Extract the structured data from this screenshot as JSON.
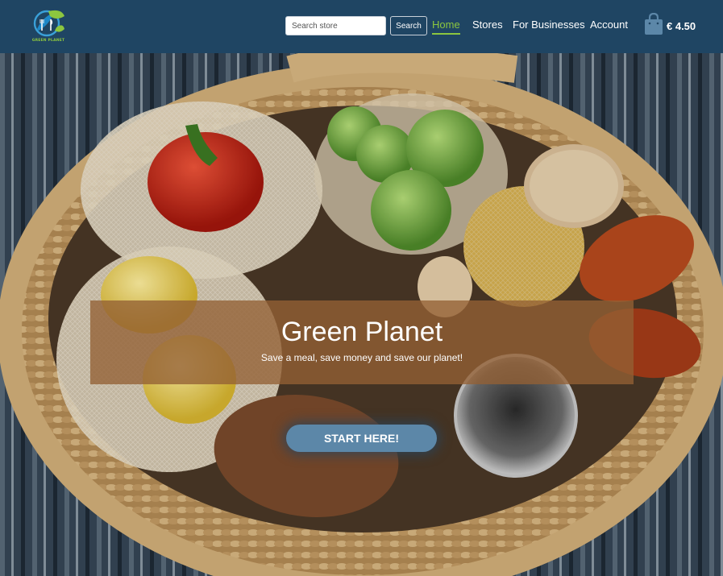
{
  "brand": {
    "logo_text": "GREEN PLANET",
    "colors": {
      "navbar": "#1f4563",
      "accent": "#8cc63f",
      "cta": "#5c87a8"
    }
  },
  "search": {
    "placeholder": "Search store",
    "value": "",
    "button_label": "Search"
  },
  "nav": {
    "home": "Home",
    "stores": "Stores",
    "businesses": "For Businesses",
    "account": "Account",
    "active": "Home"
  },
  "cart": {
    "icon": "shopping-bag-icon",
    "amount": "€ 4.50"
  },
  "hero": {
    "image": "wicker-basket-with-vegetables-photo",
    "title": "Green Planet",
    "subtitle": "Save a meal, save money and save our planet!",
    "cta_label": "START HERE!"
  }
}
